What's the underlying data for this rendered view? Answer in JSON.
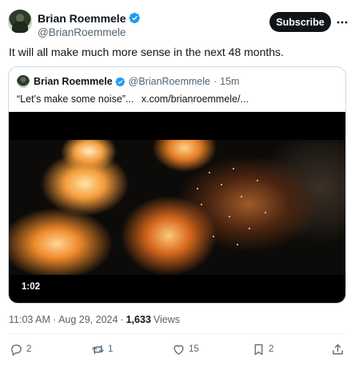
{
  "author": {
    "display_name": "Brian Roemmele",
    "handle": "@BrianRoemmele",
    "verified": true
  },
  "subscribe_label": "Subscribe",
  "tweet_text": "It will all make much more sense in the next 48 months.",
  "quote": {
    "display_name": "Brian Roemmele",
    "handle": "@BrianRoemmele",
    "time": "15m",
    "text": "“Let’s make some noise”...",
    "link": "x.com/brianroemmele/...",
    "video_duration": "1:02"
  },
  "meta": {
    "time": "11:03 AM",
    "date": "Aug 29, 2024",
    "views_count": "1,633",
    "views_label": "Views"
  },
  "actions": {
    "replies": "2",
    "reposts": "1",
    "likes": "15",
    "bookmarks": "2"
  },
  "colors": {
    "verified_blue": "#1d9bf0",
    "text_primary": "#0f1419",
    "text_secondary": "#536471",
    "border": "#cfd9de"
  }
}
